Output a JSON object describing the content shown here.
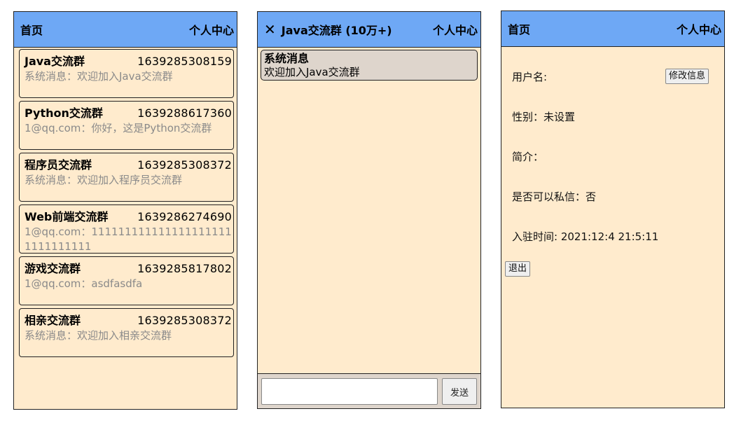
{
  "list_panel": {
    "header": {
      "home": "首页",
      "profile": "个人中心"
    },
    "conversations": [
      {
        "name": "Java交流群",
        "time": "1639285308159",
        "last": "系统消息：欢迎加入Java交流群"
      },
      {
        "name": "Python交流群",
        "time": "1639288617360",
        "last": "1@qq.com：你好，这是Python交流群"
      },
      {
        "name": "程序员交流群",
        "time": "1639285308372",
        "last": "系统消息：欢迎加入程序员交流群"
      },
      {
        "name": "Web前端交流群",
        "time": "1639286274690",
        "last": "1@qq.com：1111111111111111111111111111111"
      },
      {
        "name": "游戏交流群",
        "time": "1639285817802",
        "last": "1@qq.com：asdfasdfa"
      },
      {
        "name": "相亲交流群",
        "time": "1639285308372",
        "last": "系统消息：欢迎加入相亲交流群"
      }
    ]
  },
  "chat_panel": {
    "header": {
      "close_icon": "close-x-icon",
      "title": "Java交流群 (10万+)",
      "profile": "个人中心"
    },
    "messages": [
      {
        "sender": "系统消息",
        "text": "欢迎加入Java交流群"
      }
    ],
    "input": {
      "value": "",
      "placeholder": ""
    },
    "send_label": "发送"
  },
  "profile_panel": {
    "header": {
      "home": "首页",
      "profile": "个人中心"
    },
    "username_label": "用户名:",
    "edit_label": "修改信息",
    "gender": "性别：未设置",
    "intro": "简介：",
    "dm_allowed": "是否可以私信：否",
    "joined": "入驻时间: 2021:12:4 21:5:11",
    "logout_label": "退出"
  },
  "colors": {
    "header_bg": "#6ea8f5",
    "panel_bg": "#ffebcd",
    "bubble_bg": "#ded5cc",
    "muted_text": "#8a8a8a"
  }
}
